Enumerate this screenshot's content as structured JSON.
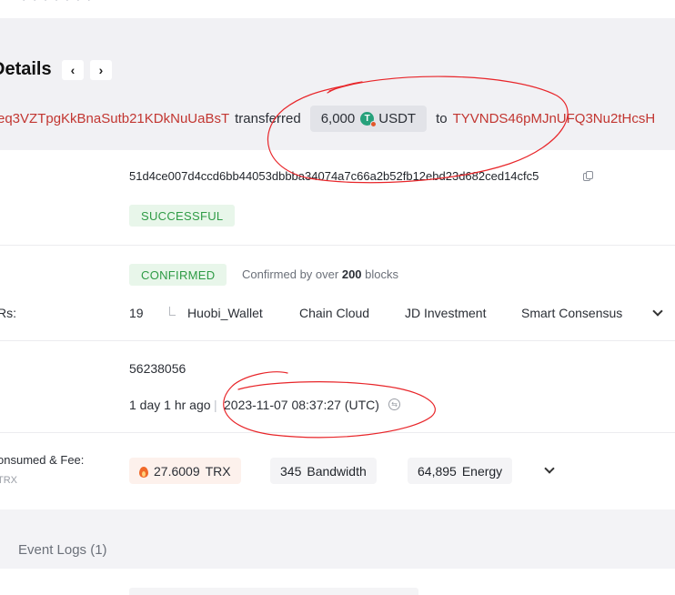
{
  "header": {
    "title": "Details",
    "prev_label": "‹",
    "next_label": "›"
  },
  "transfer": {
    "from_address": "eq3VZTpgKkBnaSutb21KDkNuUaBsT",
    "verb": "transferred",
    "amount": "6,000",
    "token_logo": "T",
    "token": "USDT",
    "to_word": "to",
    "to_address": "TYVNDS46pMJnUFQ3Nu2tHcsH"
  },
  "hash_section": {
    "hash": "51d4ce007d4ccd6bb44053dbbba34074a7c66a2b52fb12ebd23d682ced14cfc5",
    "status": "SUCCESSFUL"
  },
  "confirm_section": {
    "badge": "CONFIRMED",
    "prefix": "Confirmed by over",
    "blocks": "200",
    "suffix": "blocks"
  },
  "srs": {
    "label": "Rs:",
    "count": "19",
    "items": [
      "Huobi_Wallet",
      "Chain Cloud",
      "JD Investment",
      "Smart Consensus"
    ]
  },
  "block": {
    "number": "56238056",
    "time_ago": "1 day 1 hr ago",
    "separator": "|",
    "timestamp": "2023-11-07 08:37:27 (UTC)",
    "clock_glyph": "⇆"
  },
  "resources": {
    "label": "onsumed & Fee:",
    "sublabel": "TRX",
    "fee_value": "27.6009",
    "fee_unit": "TRX",
    "bandwidth_value": "345",
    "bandwidth_unit": "Bandwidth",
    "energy_value": "64,895",
    "energy_unit": "Energy"
  },
  "tabs": {
    "event_logs": "Event Logs (1)"
  },
  "colors": {
    "address_red": "#c23631",
    "success_green": "#2e9b45",
    "badge_bg": "#e8f6ea",
    "annotation_red": "#e8262a",
    "usdt_green": "#26a17b"
  }
}
